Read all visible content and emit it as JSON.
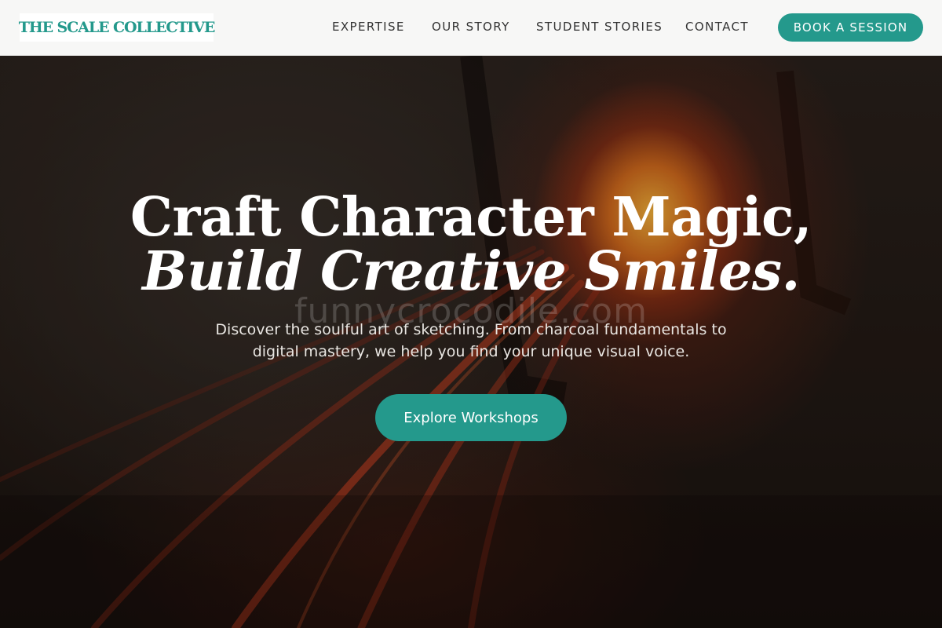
{
  "header": {
    "logo_text": "THE SCALE COLLECTIVE",
    "nav": {
      "expertise": "EXPERTISE",
      "story": "OUR STORY",
      "students": "STUDENT STORIES",
      "contact": "CONTACT"
    },
    "cta_label": "BOOK A SESSION"
  },
  "hero": {
    "title_line1": "Craft Character Magic,",
    "title_line2": "Build Creative Smiles.",
    "subtitle": "Discover the soulful art of sketching. From charcoal fundamentals to digital mastery, we help you find your unique visual voice.",
    "cta_label": "Explore Workshops",
    "watermark": "funnycrocodile.com"
  },
  "colors": {
    "accent": "#24998c",
    "header_bg": "#f7f7f6",
    "hero_text": "#ffffff"
  }
}
